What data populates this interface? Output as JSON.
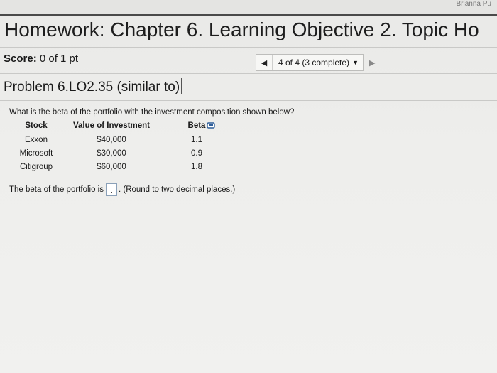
{
  "header": {
    "user_name": "Brianna Pu",
    "title": "Homework: Chapter 6. Learning Objective 2. Topic Ho"
  },
  "score": {
    "label": "Score:",
    "value": "0 of 1 pt"
  },
  "navigation": {
    "prev_icon": "triangle-left-icon",
    "position_label": "4 of 4 (3 complete)",
    "dropdown_icon": "triangle-down-icon",
    "next_icon": "triangle-right-icon"
  },
  "problem": {
    "title": "Problem 6.LO2.35 (similar to)",
    "question": "What is the beta of the portfolio with the investment composition shown below?",
    "table": {
      "headers": [
        "Stock",
        "Value of Investment",
        "Beta"
      ],
      "rows": [
        [
          "Exxon",
          "$40,000",
          "1.1"
        ],
        [
          "Microsoft",
          "$30,000",
          "0.9"
        ],
        [
          "Citigroup",
          "$60,000",
          "1.8"
        ]
      ]
    },
    "copy_icon": "copy-data-icon",
    "answer_prefix": "The beta of the portfolio is",
    "answer_value": "",
    "answer_suffix": ". (Round to two decimal places.)"
  }
}
